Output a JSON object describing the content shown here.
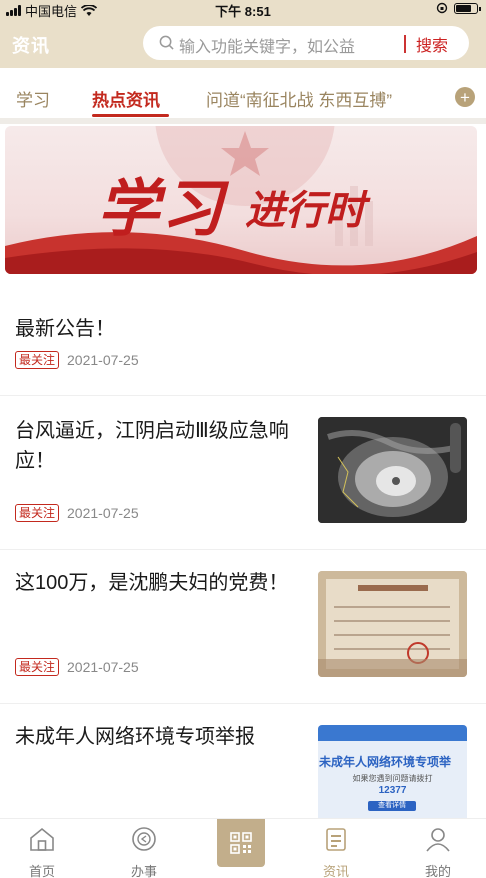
{
  "status_bar": {
    "carrier": "中国电信",
    "time": "下午 8:51"
  },
  "header": {
    "title": "资讯",
    "search_placeholder": "输入功能关键字，如公益",
    "search_button": "搜索"
  },
  "tabs": [
    {
      "label": "学习",
      "active": false
    },
    {
      "label": "热点资讯",
      "active": true
    },
    {
      "label": "问道“南征北战 东西互搏”",
      "active": false
    }
  ],
  "banner": {
    "title": "学习",
    "subtitle": "进行时"
  },
  "news": [
    {
      "title": "最新公告！",
      "tag": "最关注",
      "date": "2021-07-25",
      "thumbnail": null
    },
    {
      "title": "台风逼近，江阴启动Ⅲ级应急响应！",
      "tag": "最关注",
      "date": "2021-07-25",
      "thumbnail": "typhoon-satellite-image"
    },
    {
      "title": "这100万，是沈鹏夫妇的党费！",
      "tag": "最关注",
      "date": "2021-07-25",
      "thumbnail": "party-fee-receipt-image"
    },
    {
      "title": "未成年人网络环境专项举报",
      "tag": "",
      "date": "",
      "thumbnail": "report-poster-image",
      "thumb_text": {
        "headline": "未成年人网络环境专项举",
        "line": "如果您遇到问题请拨打",
        "phone": "12377",
        "button": "查看详情"
      }
    }
  ],
  "tabbar": [
    {
      "label": "首页",
      "icon": "home-icon",
      "active": false
    },
    {
      "label": "办事",
      "icon": "service-icon",
      "active": false
    },
    {
      "label": "",
      "icon": "qrcode-icon",
      "active": false
    },
    {
      "label": "资讯",
      "icon": "news-icon",
      "active": true
    },
    {
      "label": "我的",
      "icon": "user-icon",
      "active": false
    }
  ],
  "colors": {
    "header_bg": "#e9dfc9",
    "accent_red": "#c3291e",
    "gold": "#b8a279"
  }
}
